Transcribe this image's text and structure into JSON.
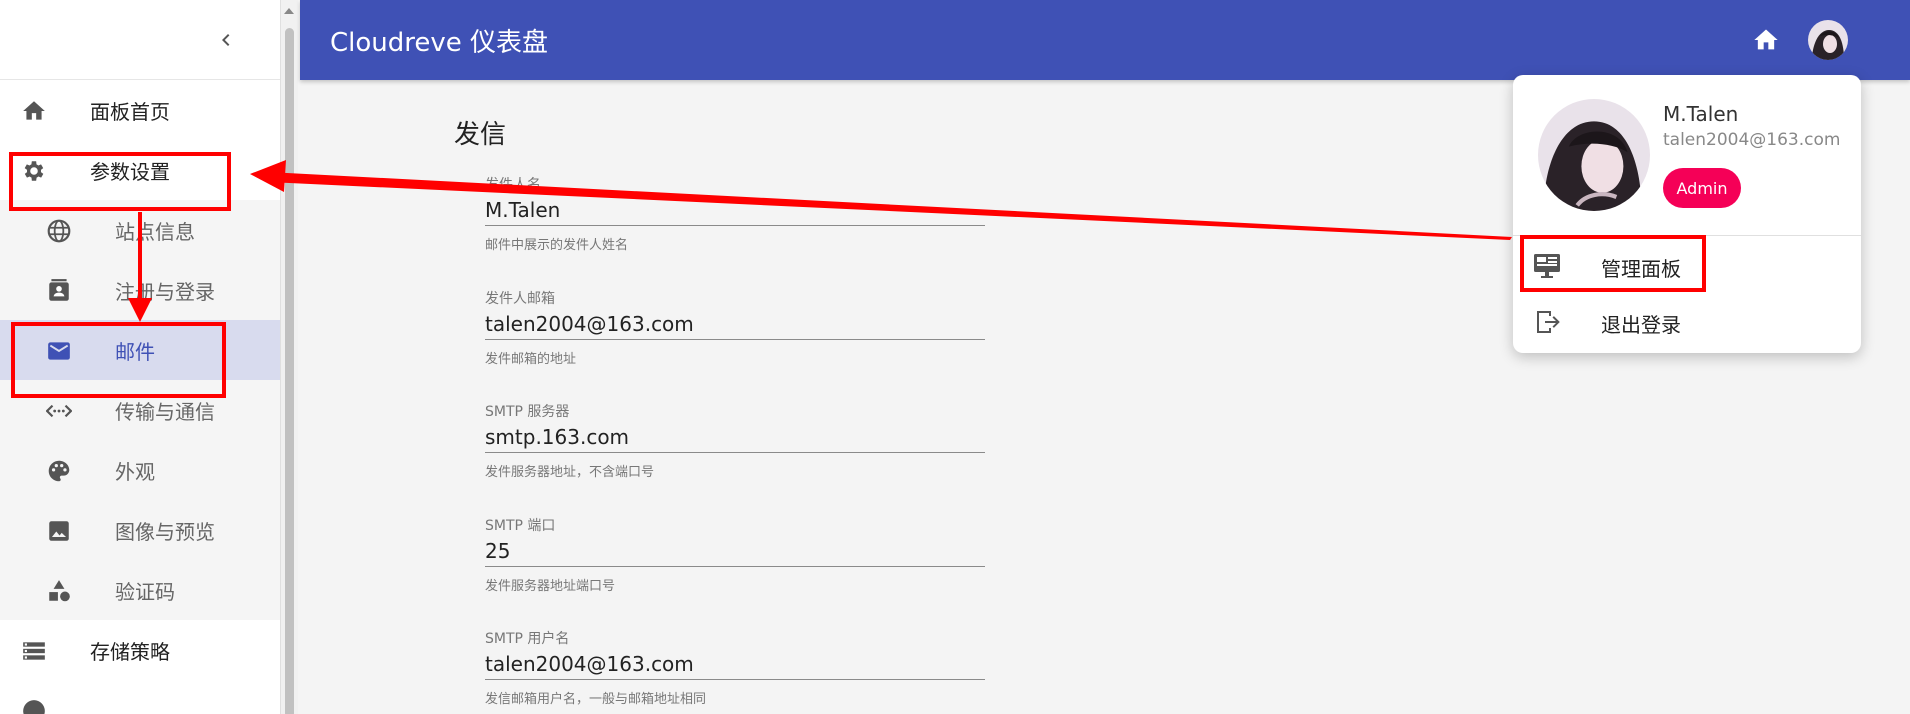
{
  "app": {
    "title": "Cloudreve 仪表盘"
  },
  "sidebar": {
    "items": [
      {
        "label": "面板首页",
        "icon": "home-icon"
      },
      {
        "label": "参数设置",
        "icon": "gear-icon"
      },
      {
        "label": "站点信息",
        "icon": "globe-icon"
      },
      {
        "label": "注册与登录",
        "icon": "contact-card-icon"
      },
      {
        "label": "邮件",
        "icon": "mail-icon"
      },
      {
        "label": "传输与通信",
        "icon": "code-arrows-icon"
      },
      {
        "label": "外观",
        "icon": "palette-icon"
      },
      {
        "label": "图像与预览",
        "icon": "image-icon"
      },
      {
        "label": "验证码",
        "icon": "shapes-icon"
      },
      {
        "label": "存储策略",
        "icon": "storage-list-icon"
      }
    ]
  },
  "main": {
    "section_title": "发信",
    "fields": [
      {
        "label": "发件人名",
        "value": "M.Talen",
        "help": "邮件中展示的发件人姓名"
      },
      {
        "label": "发件人邮箱",
        "value": "talen2004@163.com",
        "help": "发件邮箱的地址"
      },
      {
        "label": "SMTP 服务器",
        "value": "smtp.163.com",
        "help": "发件服务器地址，不含端口号"
      },
      {
        "label": "SMTP 端口",
        "value": "25",
        "help": "发件服务器地址端口号"
      },
      {
        "label": "SMTP 用户名",
        "value": "talen2004@163.com",
        "help": "发信邮箱用户名，一般与邮箱地址相同"
      }
    ]
  },
  "user_menu": {
    "name": "M.Talen",
    "email": "talen2004@163.com",
    "badge": "Admin",
    "items": [
      {
        "label": "管理面板",
        "icon": "dashboard-icon"
      },
      {
        "label": "退出登录",
        "icon": "logout-icon"
      }
    ]
  },
  "colors": {
    "primary": "#3f51b5",
    "secondary": "#f50057",
    "annotation": "#ff0000"
  }
}
